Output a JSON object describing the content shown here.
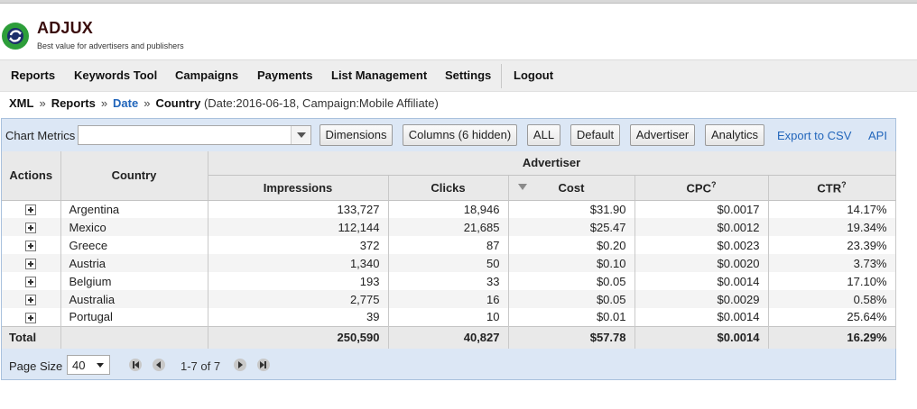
{
  "header": {
    "brand": "ADJUX",
    "tagline": "Best value for advertisers and publishers",
    "logo_colors": {
      "ring": "#2d9e3a",
      "center": "#1b2e6b"
    }
  },
  "nav": {
    "items": [
      "Reports",
      "Keywords Tool",
      "Campaigns",
      "Payments",
      "List Management",
      "Settings",
      "Logout"
    ]
  },
  "breadcrumb": {
    "items": [
      "XML",
      "Reports",
      "Date",
      "Country"
    ],
    "separator": "»",
    "details": "(Date:2016-06-18, Campaign:Mobile Affiliate)"
  },
  "toolbar": {
    "chart_metrics_label": "Chart Metrics",
    "chart_metrics_value": "",
    "buttons": [
      "Dimensions",
      "Columns (6 hidden)",
      "ALL",
      "Default",
      "Advertiser",
      "Analytics"
    ],
    "links": [
      "Export to CSV",
      "API"
    ]
  },
  "table": {
    "headers": {
      "actions": "Actions",
      "country": "Country",
      "group": "Advertiser",
      "impressions": "Impressions",
      "clicks": "Clicks",
      "cost": "Cost",
      "cpc": "CPC",
      "ctr": "CTR",
      "help_mark": "?"
    },
    "sort": {
      "column": "Cost",
      "direction": "descending"
    },
    "rows": [
      {
        "country": "Argentina",
        "impressions": "133,727",
        "clicks": "18,946",
        "cost": "$31.90",
        "cpc": "$0.0017",
        "ctr": "14.17%"
      },
      {
        "country": "Mexico",
        "impressions": "112,144",
        "clicks": "21,685",
        "cost": "$25.47",
        "cpc": "$0.0012",
        "ctr": "19.34%"
      },
      {
        "country": "Greece",
        "impressions": "372",
        "clicks": "87",
        "cost": "$0.20",
        "cpc": "$0.0023",
        "ctr": "23.39%"
      },
      {
        "country": "Austria",
        "impressions": "1,340",
        "clicks": "50",
        "cost": "$0.10",
        "cpc": "$0.0020",
        "ctr": "3.73%"
      },
      {
        "country": "Belgium",
        "impressions": "193",
        "clicks": "33",
        "cost": "$0.05",
        "cpc": "$0.0014",
        "ctr": "17.10%"
      },
      {
        "country": "Australia",
        "impressions": "2,775",
        "clicks": "16",
        "cost": "$0.05",
        "cpc": "$0.0029",
        "ctr": "0.58%"
      },
      {
        "country": "Portugal",
        "impressions": "39",
        "clicks": "10",
        "cost": "$0.01",
        "cpc": "$0.0014",
        "ctr": "25.64%"
      }
    ],
    "total": {
      "label": "Total",
      "impressions": "250,590",
      "clicks": "40,827",
      "cost": "$57.78",
      "cpc": "$0.0014",
      "ctr": "16.29%"
    }
  },
  "pager": {
    "page_size_label": "Page Size",
    "page_size": "40",
    "range": "1-7 of 7"
  }
}
